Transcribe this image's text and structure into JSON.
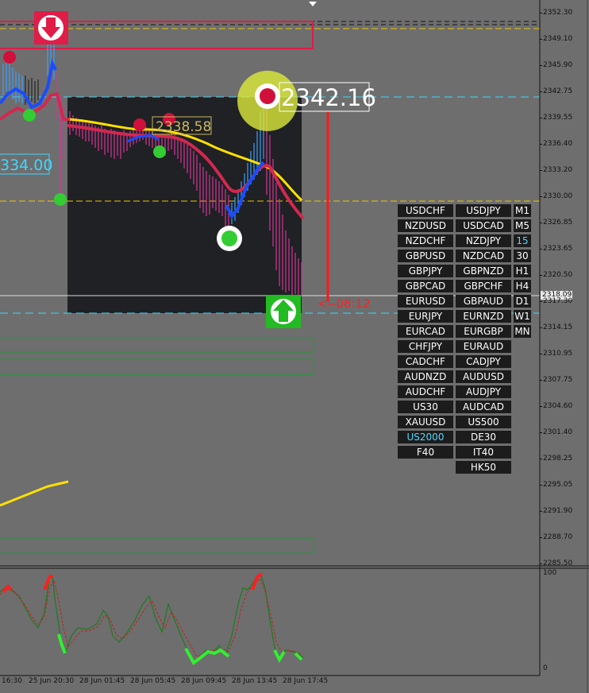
{
  "price_axis": [
    "2352.30",
    "2349.10",
    "2345.90",
    "2342.75",
    "2339.55",
    "2336.40",
    "2333.20",
    "2330.00",
    "2326.85",
    "2323.65",
    "2320.50",
    "2317.30",
    "2314.15",
    "2310.95",
    "2307.75",
    "2304.60",
    "2301.40",
    "2298.25",
    "2295.05",
    "2291.90",
    "2288.70",
    "2285.50"
  ],
  "current_price": "2318.09",
  "signal_price_label": "2342.16",
  "mid_price_label": "2338.58",
  "left_price_label": "334.00",
  "countdown": "<--08:12",
  "time_axis": [
    "16:30",
    "25 Jun 20:30",
    "28 Jun 01:45",
    "28 Jun 05:45",
    "28 Jun 09:45",
    "28 Jun 13:45",
    "28 Jun 17:45"
  ],
  "oscillator_axis": [
    "100",
    "0"
  ],
  "symbols_col1": [
    "USDCHF",
    "NZDUSD",
    "NZDCHF",
    "GBPUSD",
    "GBPJPY",
    "GBPCAD",
    "EURUSD",
    "EURJPY",
    "EURCAD",
    "CHFJPY",
    "CADCHF",
    "AUDNZD",
    "AUDCHF",
    "US30",
    "XAUUSD",
    "US2000",
    "F40"
  ],
  "symbols_col2": [
    "USDJPY",
    "USDCAD",
    "NZDJPY",
    "NZDCAD",
    "GBPNZD",
    "GBPCHF",
    "GBPAUD",
    "EURNZD",
    "EURGBP",
    "EURAUD",
    "CADJPY",
    "AUDUSD",
    "AUDJPY",
    "AUDCAD",
    "US500",
    "DE30",
    "IT40",
    "HK50"
  ],
  "timeframes": [
    "M1",
    "M5",
    "15",
    "30",
    "H1",
    "H4",
    "D1",
    "W1",
    "MN"
  ],
  "active_symbol": "US2000",
  "active_timeframe": "15",
  "colors": {
    "background": "#6e6e6e",
    "session_box": "#1f2124",
    "sell_signal": "#d0103a",
    "buy_signal": "#22bb22",
    "ma_blue": "#1a4cff",
    "ma_red": "#d32850",
    "ma_yellow": "#ffe000",
    "level_cyan": "#3fd6ff",
    "level_yellow": "#e8c800",
    "countdown": "#ff2020",
    "oscillator_green": "#1e7a1e",
    "oscillator_red": "#c02020"
  },
  "icons": {
    "sell_arrow": "down-arrow-in-circle-icon",
    "buy_arrow": "up-arrow-in-circle-icon",
    "scroll_marker": "triangle-down-icon"
  }
}
